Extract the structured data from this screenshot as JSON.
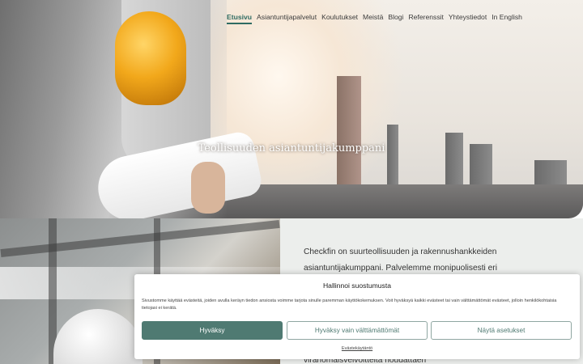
{
  "nav": {
    "items": [
      {
        "label": "Etusivu",
        "active": true
      },
      {
        "label": "Asiantuntijapalvelut"
      },
      {
        "label": "Koulutukset"
      },
      {
        "label": "Meistä"
      },
      {
        "label": "Blogi"
      },
      {
        "label": "Referenssit"
      },
      {
        "label": "Yhteystiedot"
      },
      {
        "label": "In English"
      }
    ],
    "active_color": "#2f6b62"
  },
  "hero": {
    "title": "Teollisuuden asiantuntijakumppani"
  },
  "intro": {
    "text": "Checkfin on suurteollisuuden ja rakennushankkeiden asiantuntijakumppani. Palvelemme monipuolisesti eri",
    "tail": "viranomaisvelvoitteita noudattaen"
  },
  "cookie": {
    "title": "Hallinnoi suostumusta",
    "body": "Sivustomme käyttää evästeitä, joiden avulla keräyn tiedon ansiosta voimme tarjota sinulle paremman käyttökokemuksen. Voit hyväksyä kaikki evästeet tai vain välttämättömät evästeet, jolloin henkilökohtaisia tietojasi ei kerätä.",
    "accept_label": "Hyväksy",
    "necessary_label": "Hyväksy vain välttämättömät",
    "settings_label": "Näytä asetukset",
    "policy_label": "Evästekäytäntö",
    "accent_color": "#4f7a72"
  }
}
